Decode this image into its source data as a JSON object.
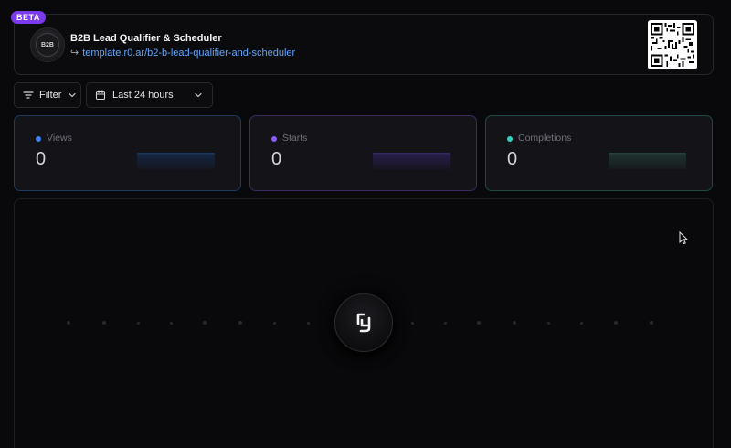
{
  "header": {
    "badge": "BETA",
    "logo_text": "B2B",
    "title": "B2B Lead Qualifier & Scheduler",
    "link_arrow": "↪",
    "link": "template.r0.ar/b2-b-lead-qualifier-and-scheduler"
  },
  "toolbar": {
    "filter_label": "Filter",
    "date_range_label": "Last 24 hours"
  },
  "stats": [
    {
      "label": "Views",
      "value": "0",
      "color": "#3b82f6"
    },
    {
      "label": "Starts",
      "value": "0",
      "color": "#8b5cf6"
    },
    {
      "label": "Completions",
      "value": "0",
      "color": "#2dd4bf"
    }
  ],
  "icons": {
    "filter": "filter-icon",
    "calendar": "calendar-icon",
    "chevron": "chevron-down-icon",
    "qr": "qr-code-icon",
    "logo": "app-logo-icon",
    "cursor": "mouse-cursor-icon"
  }
}
